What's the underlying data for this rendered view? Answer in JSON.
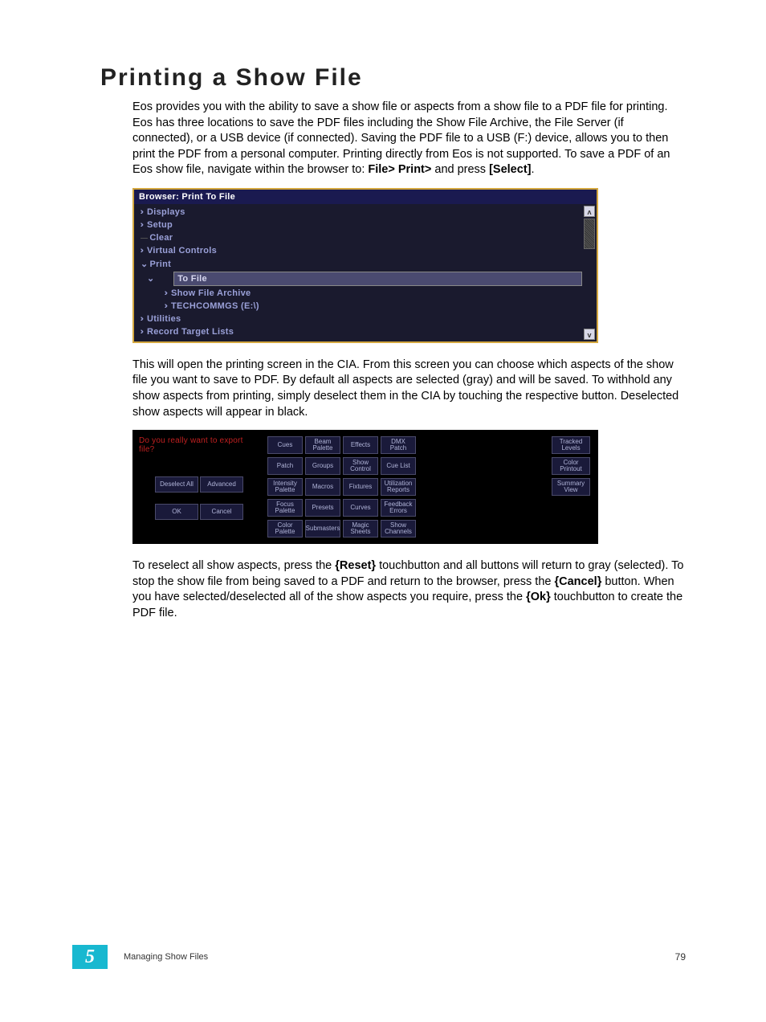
{
  "heading": "Printing a Show File",
  "para1_a": "Eos provides you with the ability to save a show file or aspects from a show file to a PDF file for printing. Eos has three locations to save the PDF files including the Show File Archive, the File Server (if connected), or a USB device (if connected). Saving the PDF file to a USB (F:) device, allows you to then print the PDF from a personal computer. Printing directly from Eos is not supported. To save a PDF of an Eos show file, navigate within the browser to: ",
  "para1_b": "File> Print> ",
  "para1_c": "and press ",
  "para1_d": "[Select]",
  "para1_e": ".",
  "browser": {
    "title": "Browser: Print To File",
    "items": [
      {
        "label": "Displays",
        "type": "chev",
        "indent": 0
      },
      {
        "label": "Setup",
        "type": "chev",
        "indent": 0
      },
      {
        "label": "Clear",
        "type": "line",
        "indent": 0
      },
      {
        "label": "Virtual Controls",
        "type": "chev",
        "indent": 0
      },
      {
        "label": "Print",
        "type": "down",
        "indent": 0
      },
      {
        "label": "To File",
        "type": "sel",
        "indent": 1
      },
      {
        "label": "Show File Archive",
        "type": "chev",
        "indent": 2
      },
      {
        "label": "TECHCOMMGS (E:\\)",
        "type": "chev",
        "indent": 2
      },
      {
        "label": "Utilities",
        "type": "chev",
        "indent": 0
      },
      {
        "label": "Record Target Lists",
        "type": "chev",
        "indent": 0
      }
    ],
    "scroll_up": "ʌ",
    "scroll_dn": "v"
  },
  "para2": "This will open the printing screen in the CIA. From this screen you can choose which aspects of the show file you want to save to PDF. By default all aspects are selected (gray) and will be saved. To withhold any show aspects from printing, simply deselect them in the CIA by touching the respective button. Deselected show aspects will appear in black.",
  "cia": {
    "prompt": "Do you really want to export file?",
    "left": {
      "deselect": "Deselect All",
      "advanced": "Advanced",
      "ok": "OK",
      "cancel": "Cancel"
    },
    "grid": [
      "Cues",
      "Beam Palette",
      "Effects",
      "DMX Patch",
      "Patch",
      "Groups",
      "Show Control",
      "Cue List",
      "Intensity Palette",
      "Macros",
      "Fixtures",
      "Utilization Reports",
      "Focus Palette",
      "Presets",
      "Curves",
      "Feedback Errors",
      "Color Palette",
      "Submasters",
      "Magic Sheets",
      "Show Channels"
    ],
    "right": [
      "Tracked Levels",
      "Color Printout",
      "Summary View"
    ]
  },
  "para3_a": "To reselect all show aspects, press the ",
  "para3_b": "{Reset}",
  "para3_c": " touchbutton and all buttons will return to gray (selected). To stop the show file from being saved to a PDF and return to the browser, press the ",
  "para3_d": "{Cancel}",
  "para3_e": " button. When you have selected/deselected all of the show aspects you require, press the ",
  "para3_f": "{Ok}",
  "para3_g": " touchbutton to create the PDF file.",
  "footer": {
    "chapter": "5",
    "label": "Managing Show Files",
    "page": "79"
  }
}
